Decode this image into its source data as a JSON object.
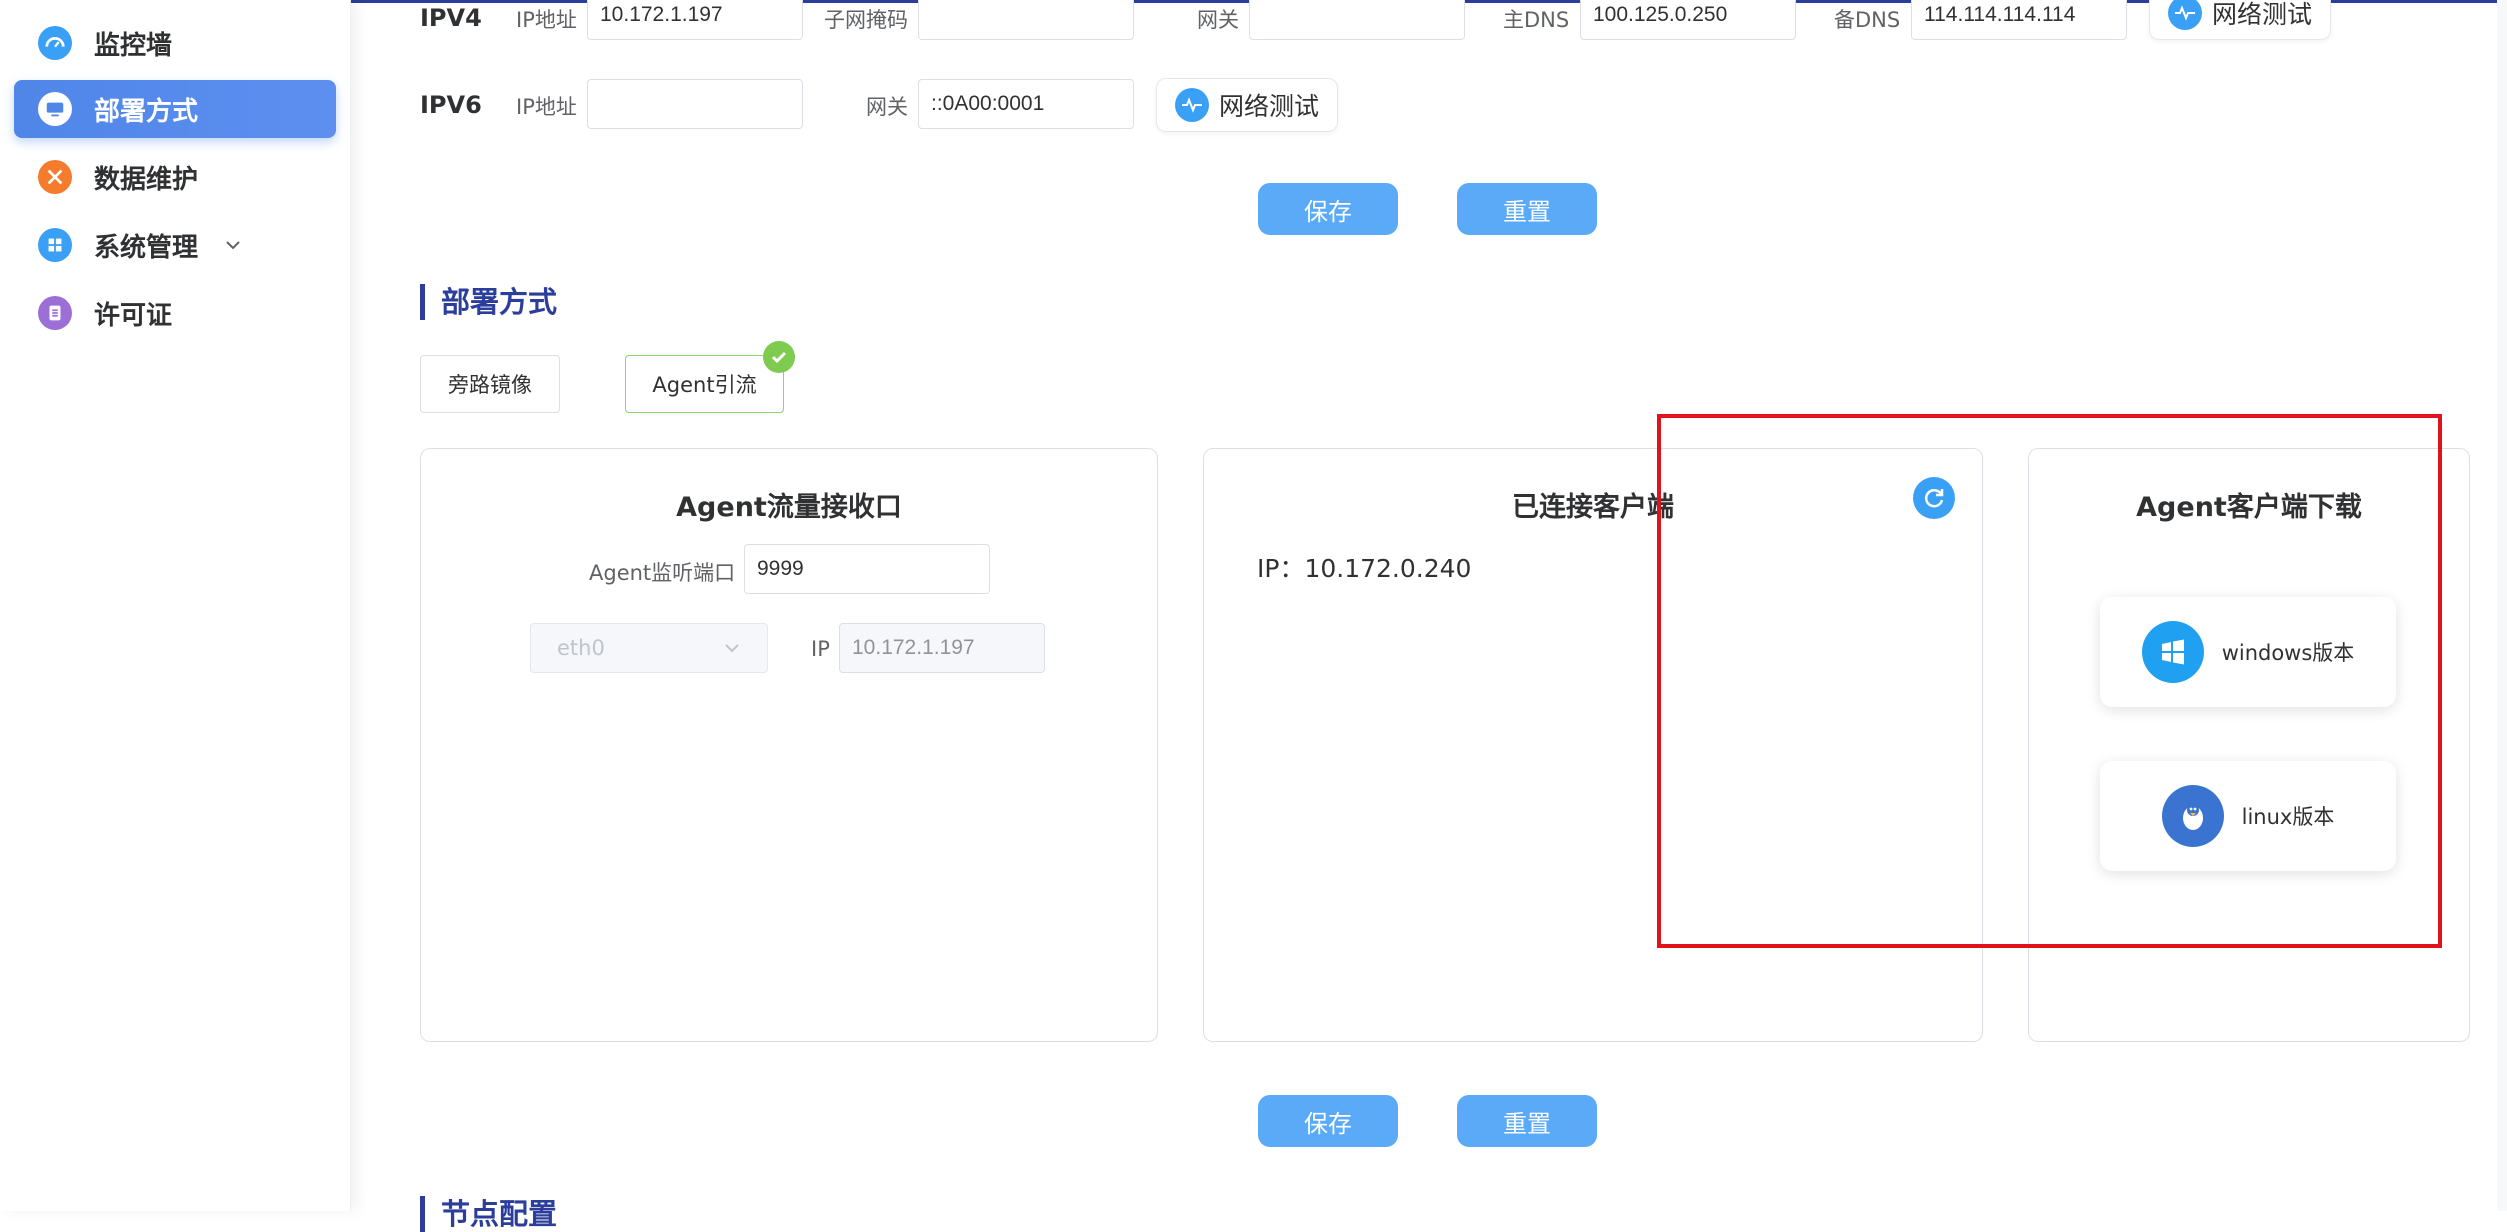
{
  "sidebar": {
    "items": [
      {
        "label": "监控墙",
        "icon": "dashboard-icon",
        "color": "#3aa0f5"
      },
      {
        "label": "部署方式",
        "icon": "monitor-icon",
        "color": "#ffffff",
        "active": true
      },
      {
        "label": "数据维护",
        "icon": "tools-icon",
        "color": "#f47c2c"
      },
      {
        "label": "系统管理",
        "icon": "windows-grid-icon",
        "color": "#3aa0f5"
      },
      {
        "label": "许可证",
        "icon": "license-icon",
        "color": "#9b6fd6"
      }
    ]
  },
  "network": {
    "ipv4": {
      "label": "IPV4",
      "ip_label": "IP地址",
      "ip_value": "10.172.1.197",
      "mask_label": "子网掩码",
      "mask_value": "",
      "gateway_label": "网关",
      "gateway_value": "",
      "dns1_label": "主DNS",
      "dns1_value": "100.125.0.250",
      "dns2_label": "备DNS",
      "dns2_value": "114.114.114.114",
      "test_label": "网络测试"
    },
    "ipv6": {
      "label": "IPV6",
      "ip_label": "IP地址",
      "ip_value": "",
      "gateway_label": "网关",
      "gateway_value": "::0A00:0001",
      "test_label": "网络测试"
    },
    "save_label": "保存",
    "reset_label": "重置"
  },
  "deploy": {
    "section_title": "部署方式",
    "modes": [
      {
        "label": "旁路镜像",
        "selected": false
      },
      {
        "label": "Agent引流",
        "selected": true
      }
    ],
    "receiver": {
      "title": "Agent流量接收口",
      "port_label": "Agent监听端口",
      "port_value": "9999",
      "interface_value": "eth0",
      "ip_label": "IP",
      "ip_value": "10.172.1.197"
    },
    "clients": {
      "title": "已连接客户端",
      "entries": [
        "IP：10.172.0.240"
      ]
    },
    "download": {
      "title": "Agent客户端下载",
      "windows_label": "windows版本",
      "linux_label": "linux版本"
    },
    "save_label": "保存",
    "reset_label": "重置"
  },
  "next_section_title": "节点配置",
  "colors": {
    "accent": "#2c3e9c",
    "primary_button": "#5aaaf7",
    "active_nav": "#4f86e8",
    "success": "#7ecb4f",
    "highlight": "#e0121b"
  }
}
